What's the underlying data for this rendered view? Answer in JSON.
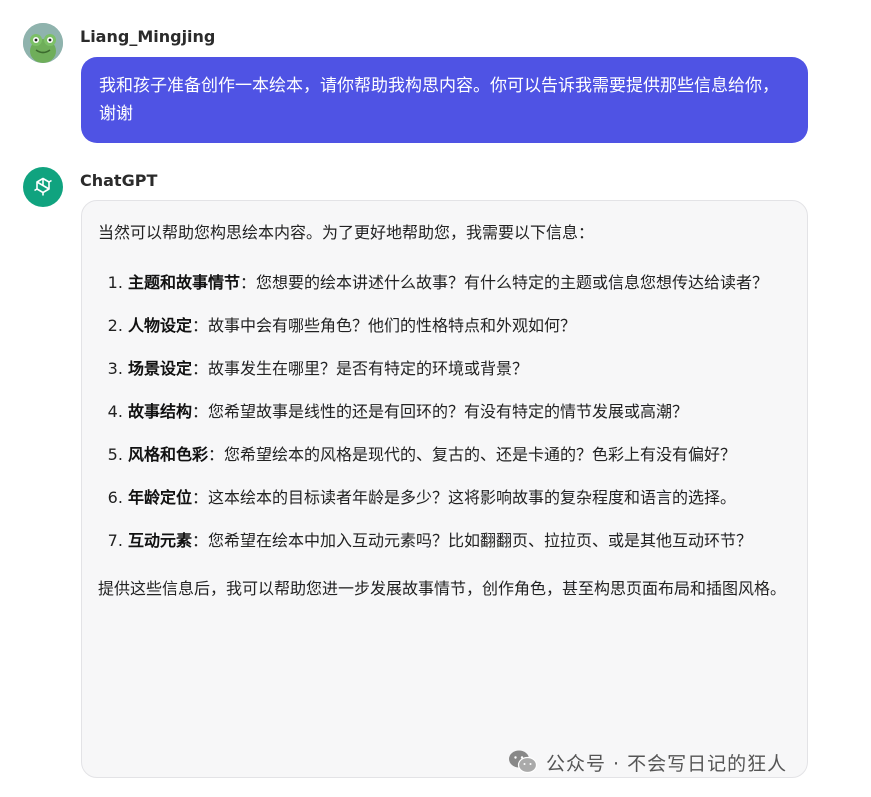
{
  "user": {
    "name": "Liang_Mingjing",
    "message": "我和孩子准备创作一本绘本，请你帮助我构思内容。你可以告诉我需要提供那些信息给你，谢谢"
  },
  "assistant": {
    "name": "ChatGPT",
    "intro": "当然可以帮助您构思绘本内容。为了更好地帮助您，我需要以下信息：",
    "items": [
      {
        "title": "主题和故事情节",
        "text": "：您想要的绘本讲述什么故事？有什么特定的主题或信息您想传达给读者？"
      },
      {
        "title": "人物设定",
        "text": "：故事中会有哪些角色？他们的性格特点和外观如何？"
      },
      {
        "title": "场景设定",
        "text": "：故事发生在哪里？是否有特定的环境或背景？"
      },
      {
        "title": "故事结构",
        "text": "：您希望故事是线性的还是有回环的？有没有特定的情节发展或高潮？"
      },
      {
        "title": "风格和色彩",
        "text": "：您希望绘本的风格是现代的、复古的、还是卡通的？色彩上有没有偏好？"
      },
      {
        "title": "年龄定位",
        "text": "：这本绘本的目标读者年龄是多少？这将影响故事的复杂程度和语言的选择。"
      },
      {
        "title": "互动元素",
        "text": "：您希望在绘本中加入互动元素吗？比如翻翻页、拉拉页、或是其他互动环节？"
      }
    ],
    "outro": "提供这些信息后，我可以帮助您进一步发展故事情节，创作角色，甚至构思页面布局和插图风格。"
  },
  "watermark": {
    "text": "公众号 · 不会写日记的狂人",
    "icon": "wechat-icon"
  },
  "colors": {
    "user_bubble": "#4f53e4",
    "assistant_bubble": "#f7f7f8",
    "chatgpt_brand": "#10a37f"
  }
}
